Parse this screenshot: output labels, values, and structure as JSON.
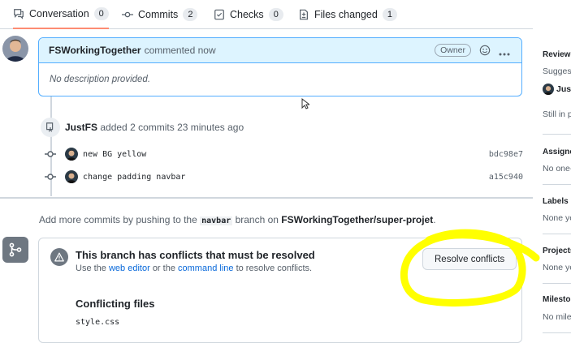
{
  "tabs": [
    {
      "label": "Conversation",
      "count": "0",
      "icon": "conversation-icon"
    },
    {
      "label": "Commits",
      "count": "2",
      "icon": "commit-icon"
    },
    {
      "label": "Checks",
      "count": "0",
      "icon": "checks-icon"
    },
    {
      "label": "Files changed",
      "count": "1",
      "icon": "file-diff-icon"
    }
  ],
  "comment": {
    "author": "FSWorkingTogether",
    "meta": "commented now",
    "badge": "Owner",
    "body": "No description provided."
  },
  "timeline": {
    "pusher": "JustFS",
    "push_text": "added 2 commits 23 minutes ago",
    "commits": [
      {
        "message": "new BG yellow",
        "sha": "bdc98e7"
      },
      {
        "message": "change padding navbar",
        "sha": "a15c940"
      }
    ]
  },
  "hint": {
    "prefix": "Add more commits by pushing to the",
    "branch": "navbar",
    "middle": "branch on",
    "repo": "FSWorkingTogether/super-projet",
    "suffix": "."
  },
  "merge": {
    "title": "This branch has conflicts that must be resolved",
    "sub_use": "Use the",
    "web_editor": "web editor",
    "sub_or": "or the",
    "command_line": "command line",
    "sub_tail": "to resolve conflicts.",
    "resolve_label": "Resolve conflicts",
    "files_title": "Conflicting files",
    "files": [
      "style.css"
    ]
  },
  "sidebar": {
    "reviewers_h": "Reviewe",
    "reviewers_sugg": "Suggest",
    "reviewer_name": "Just",
    "reviewers_status": "Still in p",
    "assignees_h": "Assigne",
    "assignees_v": "No one-",
    "labels_h": "Labels",
    "labels_v": "None ye",
    "projects_h": "Projects",
    "projects_v": "None ye",
    "milestone_h": "Milesto",
    "milestone_v": "No mile"
  },
  "colors": {
    "accent_tab": "#fd8c73",
    "comment_border": "#54aeff",
    "comment_header": "#ddf4ff",
    "link": "#0969da",
    "highlight": "#ffff00"
  }
}
